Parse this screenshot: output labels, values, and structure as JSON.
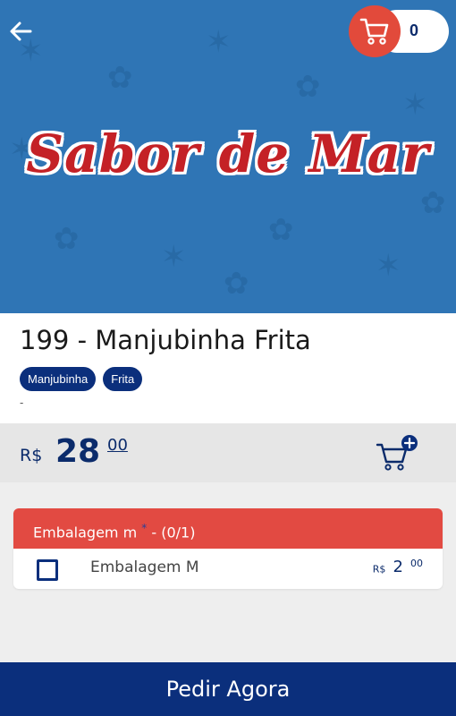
{
  "header": {
    "logo_text": "Sabor de Mar",
    "cart_count": "0"
  },
  "product": {
    "title": "199 - Manjubinha Frita",
    "tags": [
      "Manjubinha",
      "Frita"
    ],
    "description": "-",
    "price": {
      "currency": "R$",
      "integer": "28",
      "cents": "00"
    }
  },
  "options": {
    "group_name": "Embalagem m",
    "required_mark": "*",
    "counter": "- (0/1)",
    "items": [
      {
        "label": "Embalagem M",
        "currency": "R$",
        "price_integer": "2",
        "price_cents": "00",
        "checked": false
      }
    ]
  },
  "order_button": {
    "label": "Pedir Agora"
  },
  "colors": {
    "banner_blue": "#2f75b5",
    "brand_navy": "#0b2f7c",
    "accent_red": "#e24a42",
    "logo_red": "#c42126"
  }
}
